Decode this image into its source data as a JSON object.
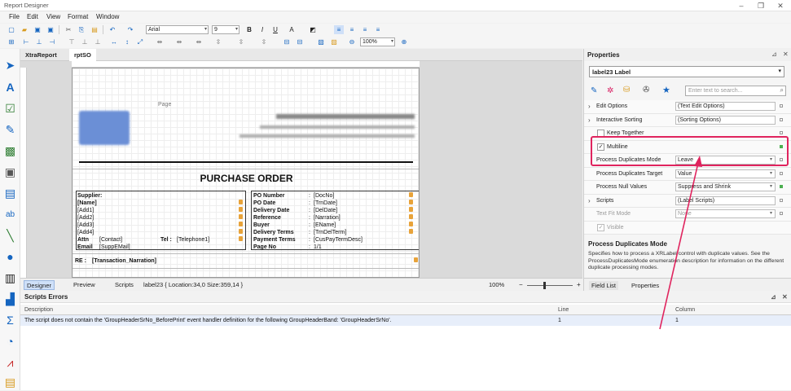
{
  "window": {
    "title": "Report Designer"
  },
  "menu": [
    "File",
    "Edit",
    "View",
    "Format",
    "Window"
  ],
  "toolbar": {
    "font": "Arial",
    "font_size": "9",
    "zoom": "100%"
  },
  "tabs": {
    "a": "XtraReport",
    "b": "rptSO"
  },
  "report": {
    "page_header_label": "Page",
    "title": "PURCHASE ORDER",
    "left": {
      "supplier": "Supplier:",
      "name": "[Name]",
      "add1": "[Add1]",
      "add2": "[Add2]",
      "add3": "[Add3]",
      "add4": "[Add4]",
      "attn": "Attn",
      "contact": "[Contact]",
      "tel": "Tel :",
      "telephone": "[Telephone1]",
      "email": "Email",
      "suppemail": "[SuppEMail]"
    },
    "right_labels": [
      "PO Number",
      "PO Date",
      "Delivery Date",
      "Reference",
      "Buyer",
      "Delivery Terms",
      "Payment Terms",
      "Page No"
    ],
    "right_values": [
      "[DocNo]",
      "[TrnDate]",
      "[DelDate]",
      "[Narration]",
      "[EName]",
      "[TrnDelTerm]",
      "[CusPayTermDesc]",
      "1/1"
    ],
    "re": "RE :",
    "narration": "[Transaction_Narration]"
  },
  "status": {
    "designer": "Designer",
    "preview": "Preview",
    "scripts": "Scripts",
    "info": "label23 { Location:34,0 Size:359,14 }",
    "zoom": "100%"
  },
  "errors": {
    "title": "Scripts Errors",
    "col_desc": "Description",
    "col_line": "Line",
    "col_column": "Column",
    "row": {
      "desc": "The script does not contain the 'GroupHeaderSrNo_BeforePrint' event handler definition for the following GroupHeaderBand: 'GroupHeaderSrNo'.",
      "line": "1",
      "column": "1"
    }
  },
  "props": {
    "title": "Properties",
    "selector": "label23   Label",
    "search": "Enter text to search...",
    "rows": [
      {
        "name": "Edit Options",
        "value": "(Text Edit Options)",
        "exp": "›",
        "dd": ""
      },
      {
        "name": "Interactive Sorting",
        "value": "(Sorting Options)",
        "exp": "›",
        "dd": ""
      },
      {
        "name": "Keep Together",
        "value": "",
        "exp": "",
        "dd": ""
      },
      {
        "name": "Multiline",
        "value": "",
        "exp": "",
        "dd": ""
      },
      {
        "name": "Process Duplicates Mode",
        "value": "Leave",
        "exp": "",
        "dd": "▾"
      },
      {
        "name": "Process Duplicates Target",
        "value": "Value",
        "exp": "",
        "dd": "▾"
      },
      {
        "name": "Process Null Values",
        "value": "Suppress and Shrink",
        "exp": "",
        "dd": "▾"
      },
      {
        "name": "Scripts",
        "value": "(Label Scripts)",
        "exp": "›",
        "dd": ""
      },
      {
        "name": "Text Fit Mode",
        "value": "None",
        "exp": "",
        "dd": "▾"
      },
      {
        "name": "Visible",
        "value": "",
        "exp": "",
        "dd": ""
      }
    ],
    "desc_title": "Process Duplicates Mode",
    "desc": "Specifies how to process a XRLabel control with duplicate values. See the ProcessDuplicatesMode enumeration description for information on the different duplicate processing modes.",
    "tab_field": "Field List",
    "tab_props": "Properties"
  }
}
